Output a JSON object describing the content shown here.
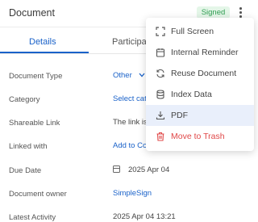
{
  "header": {
    "title": "Document",
    "status_badge": "Signed"
  },
  "tabs": [
    {
      "label": "Details"
    },
    {
      "label": "Participa"
    }
  ],
  "fields": [
    {
      "label": "Document Type",
      "value": "Other"
    },
    {
      "label": "Category",
      "value": "Select cat"
    },
    {
      "label": "Shareable Link",
      "value": "The link is"
    },
    {
      "label": "Linked with",
      "value": "Add to Co"
    },
    {
      "label": "Due Date",
      "value": "2025 Apr 04"
    },
    {
      "label": "Document owner",
      "value": "SimpleSign"
    },
    {
      "label": "Latest Activity",
      "value": "2025 Apr 04 13:21"
    }
  ],
  "menu": {
    "items": [
      {
        "label": "Full Screen",
        "icon": "expand-icon"
      },
      {
        "label": "Internal Reminder",
        "icon": "calendar-icon"
      },
      {
        "label": "Reuse Document",
        "icon": "refresh-icon"
      },
      {
        "label": "Index Data",
        "icon": "database-icon"
      },
      {
        "label": "PDF",
        "icon": "download-icon",
        "state": "highlighted"
      },
      {
        "label": "Move to Trash",
        "icon": "trash-icon",
        "color": "#e04848"
      }
    ]
  },
  "colors": {
    "accent": "#1a62c9",
    "badge_bg": "#e4f6e8",
    "badge_text": "#2f9e52",
    "danger": "#e04848",
    "menu_highlight": "#e9effb"
  }
}
